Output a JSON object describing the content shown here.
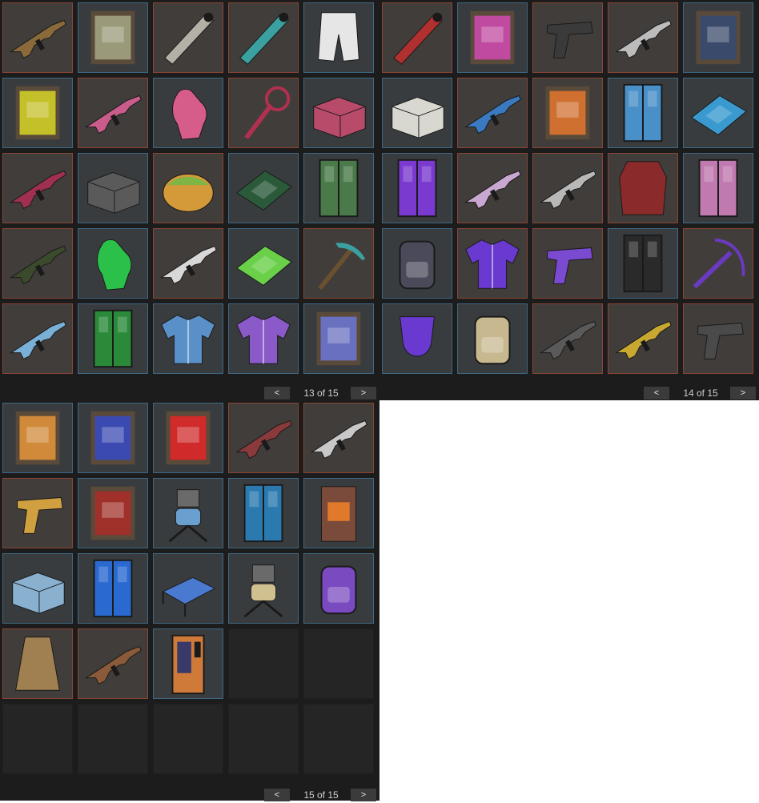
{
  "colors": {
    "panel_bg": "#1c1c1c",
    "red_slot_border": "#8a4535",
    "blue_slot_border": "#3e6783",
    "empty_slot_bg": "#252525"
  },
  "pages": [
    {
      "label": "13 of 15",
      "prev": "<",
      "next": ">",
      "items": [
        {
          "icon": "smg-icon",
          "frame": "red",
          "color": "#8a6a3a"
        },
        {
          "icon": "framed-sign-icon",
          "frame": "blue",
          "color": "#9a9a7a"
        },
        {
          "icon": "pipe-launcher-icon",
          "frame": "red",
          "color": "#b5b0a5"
        },
        {
          "icon": "shotgun-icon",
          "frame": "red",
          "color": "#3aa0a0"
        },
        {
          "icon": "shorts-icon",
          "frame": "blue",
          "color": "#e6e6e6"
        },
        {
          "icon": "framed-sign-icon",
          "frame": "blue",
          "color": "#c4c02a"
        },
        {
          "icon": "rifle-icon",
          "frame": "red",
          "color": "#c95c8a"
        },
        {
          "icon": "gloves-icon",
          "frame": "blue",
          "color": "#d65c8a"
        },
        {
          "icon": "lasso-icon",
          "frame": "red",
          "color": "#b03050"
        },
        {
          "icon": "box-icon",
          "frame": "blue",
          "color": "#b84a6a"
        },
        {
          "icon": "rifle-icon",
          "frame": "red",
          "color": "#a03050"
        },
        {
          "icon": "box-icon",
          "frame": "blue",
          "color": "#5a5a5a"
        },
        {
          "icon": "basket-icon",
          "frame": "red",
          "color": "#d49a3a"
        },
        {
          "icon": "rug-icon",
          "frame": "blue",
          "color": "#2a5a3a"
        },
        {
          "icon": "door-icon",
          "frame": "blue",
          "color": "#4a7a4a"
        },
        {
          "icon": "rifle-icon",
          "frame": "red",
          "color": "#3a4a2a"
        },
        {
          "icon": "gloves-icon",
          "frame": "blue",
          "color": "#2ac04a"
        },
        {
          "icon": "rifle-icon",
          "frame": "red",
          "color": "#d8d8d8"
        },
        {
          "icon": "rug-icon",
          "frame": "blue",
          "color": "#6ad04a"
        },
        {
          "icon": "pickaxe-icon",
          "frame": "red",
          "color": "#6a5030"
        },
        {
          "icon": "rifle-icon",
          "frame": "red",
          "color": "#7ab0d8"
        },
        {
          "icon": "locker-icon",
          "frame": "blue",
          "color": "#2a8a3a"
        },
        {
          "icon": "jacket-icon",
          "frame": "blue",
          "color": "#5a90c8"
        },
        {
          "icon": "jacket-icon",
          "frame": "blue",
          "color": "#8a5ac8"
        },
        {
          "icon": "framed-sign-icon",
          "frame": "blue",
          "color": "#6a70c0"
        }
      ]
    },
    {
      "label": "14 of 15",
      "prev": "<",
      "next": ">",
      "items": [
        {
          "icon": "pipe-launcher-icon",
          "frame": "red",
          "color": "#b03030"
        },
        {
          "icon": "framed-sign-icon",
          "frame": "blue",
          "color": "#c04aa0"
        },
        {
          "icon": "pistol-icon",
          "frame": "red",
          "color": "#3a3a3a"
        },
        {
          "icon": "rifle-icon",
          "frame": "red",
          "color": "#bcbcbc"
        },
        {
          "icon": "framed-sign-icon",
          "frame": "blue",
          "color": "#3a4a6a"
        },
        {
          "icon": "box-icon",
          "frame": "blue",
          "color": "#d8d8d0"
        },
        {
          "icon": "rifle-icon",
          "frame": "red",
          "color": "#3a7ac0"
        },
        {
          "icon": "framed-sign-icon",
          "frame": "red",
          "color": "#d07030"
        },
        {
          "icon": "locker-icon",
          "frame": "blue",
          "color": "#4a90c8"
        },
        {
          "icon": "rug-icon",
          "frame": "blue",
          "color": "#3a9ad0"
        },
        {
          "icon": "door-icon",
          "frame": "blue",
          "color": "#7a3ad0"
        },
        {
          "icon": "rifle-icon",
          "frame": "red",
          "color": "#c8a8d0"
        },
        {
          "icon": "rifle-icon",
          "frame": "red",
          "color": "#b8b8b8"
        },
        {
          "icon": "armor-icon",
          "frame": "red",
          "color": "#8a2a2a"
        },
        {
          "icon": "locker-icon",
          "frame": "blue",
          "color": "#c07ab0"
        },
        {
          "icon": "backpack-icon",
          "frame": "blue",
          "color": "#4a4a5a"
        },
        {
          "icon": "shirt-icon",
          "frame": "red",
          "color": "#6a3ad0"
        },
        {
          "icon": "pistol-icon",
          "frame": "red",
          "color": "#7a4ad0"
        },
        {
          "icon": "locker-icon",
          "frame": "blue",
          "color": "#2a2a2a"
        },
        {
          "icon": "crossbow-icon",
          "frame": "red",
          "color": "#6a3ac0"
        },
        {
          "icon": "mask-icon",
          "frame": "blue",
          "color": "#6a3ad0"
        },
        {
          "icon": "backpack-icon",
          "frame": "blue",
          "color": "#c8b890"
        },
        {
          "icon": "rifle-icon",
          "frame": "red",
          "color": "#5a5a5a"
        },
        {
          "icon": "rifle-icon",
          "frame": "red",
          "color": "#c8a830"
        },
        {
          "icon": "pistol-icon",
          "frame": "red",
          "color": "#4a4a4a"
        }
      ]
    },
    {
      "label": "15 of 15",
      "prev": "<",
      "next": ">",
      "items": [
        {
          "icon": "framed-sign-icon",
          "frame": "blue",
          "color": "#d08a3a"
        },
        {
          "icon": "framed-sign-icon",
          "frame": "blue",
          "color": "#3a4ab0"
        },
        {
          "icon": "framed-sign-icon",
          "frame": "blue",
          "color": "#d02a2a"
        },
        {
          "icon": "smg-icon",
          "frame": "red",
          "color": "#8a3a3a"
        },
        {
          "icon": "smg-icon",
          "frame": "red",
          "color": "#c8c8c8"
        },
        {
          "icon": "pistol-icon",
          "frame": "red",
          "color": "#d0a040"
        },
        {
          "icon": "framed-sign-icon",
          "frame": "blue",
          "color": "#a0302a"
        },
        {
          "icon": "turret-icon",
          "frame": "blue",
          "color": "#6aa0d0"
        },
        {
          "icon": "door-icon",
          "frame": "blue",
          "color": "#2a7ab0"
        },
        {
          "icon": "furnace-icon",
          "frame": "blue",
          "color": "#e07a2a"
        },
        {
          "icon": "box-icon",
          "frame": "blue",
          "color": "#8ab0d0"
        },
        {
          "icon": "locker-icon",
          "frame": "blue",
          "color": "#2a6ad0"
        },
        {
          "icon": "bed-icon",
          "frame": "blue",
          "color": "#4a7ad0"
        },
        {
          "icon": "turret-icon",
          "frame": "blue",
          "color": "#d0c090"
        },
        {
          "icon": "backpack-icon",
          "frame": "blue",
          "color": "#7a4ac0"
        },
        {
          "icon": "sleeping-bag-icon",
          "frame": "red",
          "color": "#a08050"
        },
        {
          "icon": "rifle-icon",
          "frame": "red",
          "color": "#8a5a3a"
        },
        {
          "icon": "vending-machine-icon",
          "frame": "blue",
          "color": "#d07a3a"
        },
        {
          "icon": "empty-slot",
          "frame": "empty",
          "color": ""
        },
        {
          "icon": "empty-slot",
          "frame": "empty",
          "color": ""
        },
        {
          "icon": "empty-slot",
          "frame": "empty",
          "color": ""
        },
        {
          "icon": "empty-slot",
          "frame": "empty",
          "color": ""
        },
        {
          "icon": "empty-slot",
          "frame": "empty",
          "color": ""
        },
        {
          "icon": "empty-slot",
          "frame": "empty",
          "color": ""
        },
        {
          "icon": "empty-slot",
          "frame": "empty",
          "color": ""
        }
      ]
    }
  ]
}
